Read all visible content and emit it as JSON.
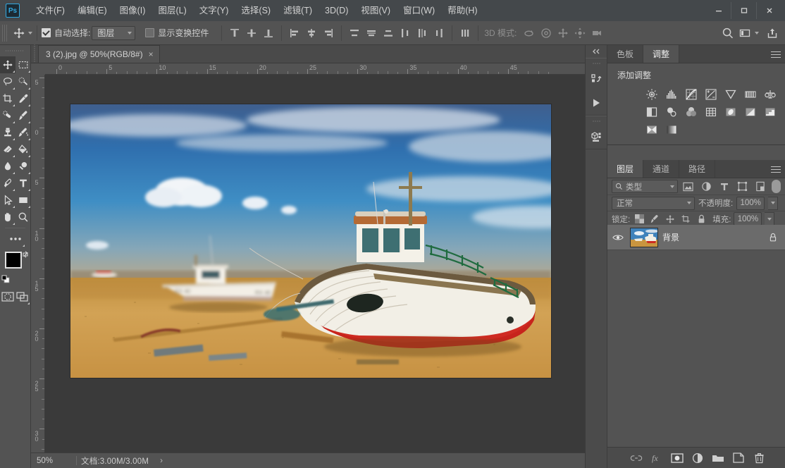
{
  "app": {
    "logo": "Ps",
    "accent": "#31a8e0"
  },
  "menubar": {
    "items": [
      {
        "label": "文件(F)",
        "name": "menu-file"
      },
      {
        "label": "编辑(E)",
        "name": "menu-edit"
      },
      {
        "label": "图像(I)",
        "name": "menu-image"
      },
      {
        "label": "图层(L)",
        "name": "menu-layer"
      },
      {
        "label": "文字(Y)",
        "name": "menu-type"
      },
      {
        "label": "选择(S)",
        "name": "menu-select"
      },
      {
        "label": "滤镜(T)",
        "name": "menu-filter"
      },
      {
        "label": "3D(D)",
        "name": "menu-3d"
      },
      {
        "label": "视图(V)",
        "name": "menu-view"
      },
      {
        "label": "窗口(W)",
        "name": "menu-window"
      },
      {
        "label": "帮助(H)",
        "name": "menu-help"
      }
    ],
    "window_controls": {
      "minimize": "minimize-icon",
      "maximize": "maximize-icon",
      "close": "close-icon"
    }
  },
  "options_bar": {
    "tool_icon": "move-tool-icon",
    "auto_select_label": "自动选择:",
    "auto_select_checked": true,
    "auto_select_value": "图层",
    "show_transform_label": "显示变换控件",
    "show_transform_checked": false,
    "mode_3d_label": "3D 模式:",
    "search_icon": "search-icon",
    "workspace_icon": "workspace-icon",
    "share_icon": "share-icon"
  },
  "document": {
    "tab_label": "3 (2).jpg @ 50%(RGB/8#)",
    "tab_close": "×",
    "ruler_h_labels": [
      "0",
      "5",
      "10",
      "15",
      "20",
      "25",
      "30",
      "35",
      "40",
      "45"
    ],
    "ruler_v_labels": [
      "5",
      "0",
      "5",
      "10",
      "15",
      "20",
      "25",
      "30"
    ],
    "canvas_alt": "两艘渔船停在沙滩上的照片"
  },
  "status_bar": {
    "zoom": "50%",
    "doc_info": "文档:3.00M/3.00M",
    "arrow": "›"
  },
  "toolbar": {
    "tools": [
      {
        "name": "move-tool",
        "icon": "move-icon",
        "active": true
      },
      {
        "name": "marquee-tool",
        "icon": "rect-marquee-icon",
        "active": false
      },
      {
        "name": "lasso-tool",
        "icon": "lasso-icon",
        "active": false
      },
      {
        "name": "quick-select-tool",
        "icon": "quick-select-icon",
        "active": false
      },
      {
        "name": "crop-tool",
        "icon": "crop-icon",
        "active": false
      },
      {
        "name": "eyedropper-tool",
        "icon": "eyedropper-icon",
        "active": false
      },
      {
        "name": "healing-brush-tool",
        "icon": "healing-brush-icon",
        "active": false
      },
      {
        "name": "brush-tool",
        "icon": "brush-icon",
        "active": false
      },
      {
        "name": "clone-stamp-tool",
        "icon": "clone-stamp-icon",
        "active": false
      },
      {
        "name": "history-brush-tool",
        "icon": "history-brush-icon",
        "active": false
      },
      {
        "name": "eraser-tool",
        "icon": "eraser-icon",
        "active": false
      },
      {
        "name": "gradient-tool",
        "icon": "paint-bucket-icon",
        "active": false
      },
      {
        "name": "blur-tool",
        "icon": "blur-drop-icon",
        "active": false
      },
      {
        "name": "dodge-tool",
        "icon": "dodge-icon",
        "active": false
      },
      {
        "name": "pen-tool",
        "icon": "pen-icon",
        "active": false
      },
      {
        "name": "type-tool",
        "icon": "type-T-icon",
        "active": false
      },
      {
        "name": "path-select-tool",
        "icon": "path-arrow-icon",
        "active": false
      },
      {
        "name": "shape-tool",
        "icon": "rectangle-shape-icon",
        "active": false
      },
      {
        "name": "hand-tool",
        "icon": "hand-icon",
        "active": false
      },
      {
        "name": "zoom-tool",
        "icon": "magnifier-icon",
        "active": false
      }
    ],
    "more_tools": "ellipsis-icon",
    "foreground_color": "#000000",
    "background_color": "#ffffff",
    "swap_colors": "swap-colors-icon",
    "default_colors": "default-colors-icon",
    "quick_mask": "quick-mask-icon",
    "screen_mode": "screen-mode-icon"
  },
  "mini_dock": {
    "collapse": "double-chevron-left-icon",
    "buttons": [
      {
        "name": "history-panel-icon",
        "label": "history-icon"
      },
      {
        "name": "actions-play-icon",
        "label": "play-icon"
      },
      {
        "name": "properties-3d-icon",
        "label": "cube-icon"
      }
    ]
  },
  "adjustments_panel": {
    "tabs": [
      {
        "label": "色板",
        "name": "tab-swatches",
        "active": false
      },
      {
        "label": "调整",
        "name": "tab-adjustments",
        "active": true
      }
    ],
    "menu_icon": "panel-menu-icon",
    "title": "添加调整",
    "icons": [
      "brightness-contrast-icon",
      "levels-icon",
      "curves-icon",
      "exposure-icon",
      "vibrance-icon",
      "hue-saturation-icon",
      "color-balance-icon",
      "black-white-icon",
      "photo-filter-icon",
      "channel-mixer-icon",
      "color-lookup-icon",
      "invert-icon",
      "posterize-icon",
      "threshold-icon",
      "selective-color-icon",
      "gradient-map-icon"
    ]
  },
  "layers_panel": {
    "tabs": [
      {
        "label": "图层",
        "name": "tab-layers",
        "active": true
      },
      {
        "label": "通道",
        "name": "tab-channels",
        "active": false
      },
      {
        "label": "路径",
        "name": "tab-paths",
        "active": false
      }
    ],
    "menu_icon": "panel-menu-icon",
    "filter_label": "类型",
    "filter_search_icon": "search-icon",
    "filter_icons": [
      "pixel-filter-icon",
      "adjustment-filter-icon",
      "type-filter-icon",
      "shape-filter-icon",
      "smart-object-filter-icon"
    ],
    "filter_toggle": "filter-toggle-icon",
    "blend_mode": "正常",
    "opacity_label": "不透明度:",
    "opacity_value": "100%",
    "lock_label": "锁定:",
    "lock_icons": [
      "lock-transparent-icon",
      "lock-image-icon",
      "lock-position-icon",
      "lock-artboard-icon",
      "lock-all-icon"
    ],
    "fill_label": "填充:",
    "fill_value": "100%",
    "layers": [
      {
        "name": "背景",
        "visible": true,
        "locked": true,
        "thumb": "boats-thumbnail"
      }
    ],
    "footer_icons": [
      "link-layers-icon",
      "layer-style-fx-icon",
      "add-mask-icon",
      "new-adjustment-icon",
      "new-group-icon",
      "new-layer-icon",
      "delete-layer-icon"
    ]
  }
}
